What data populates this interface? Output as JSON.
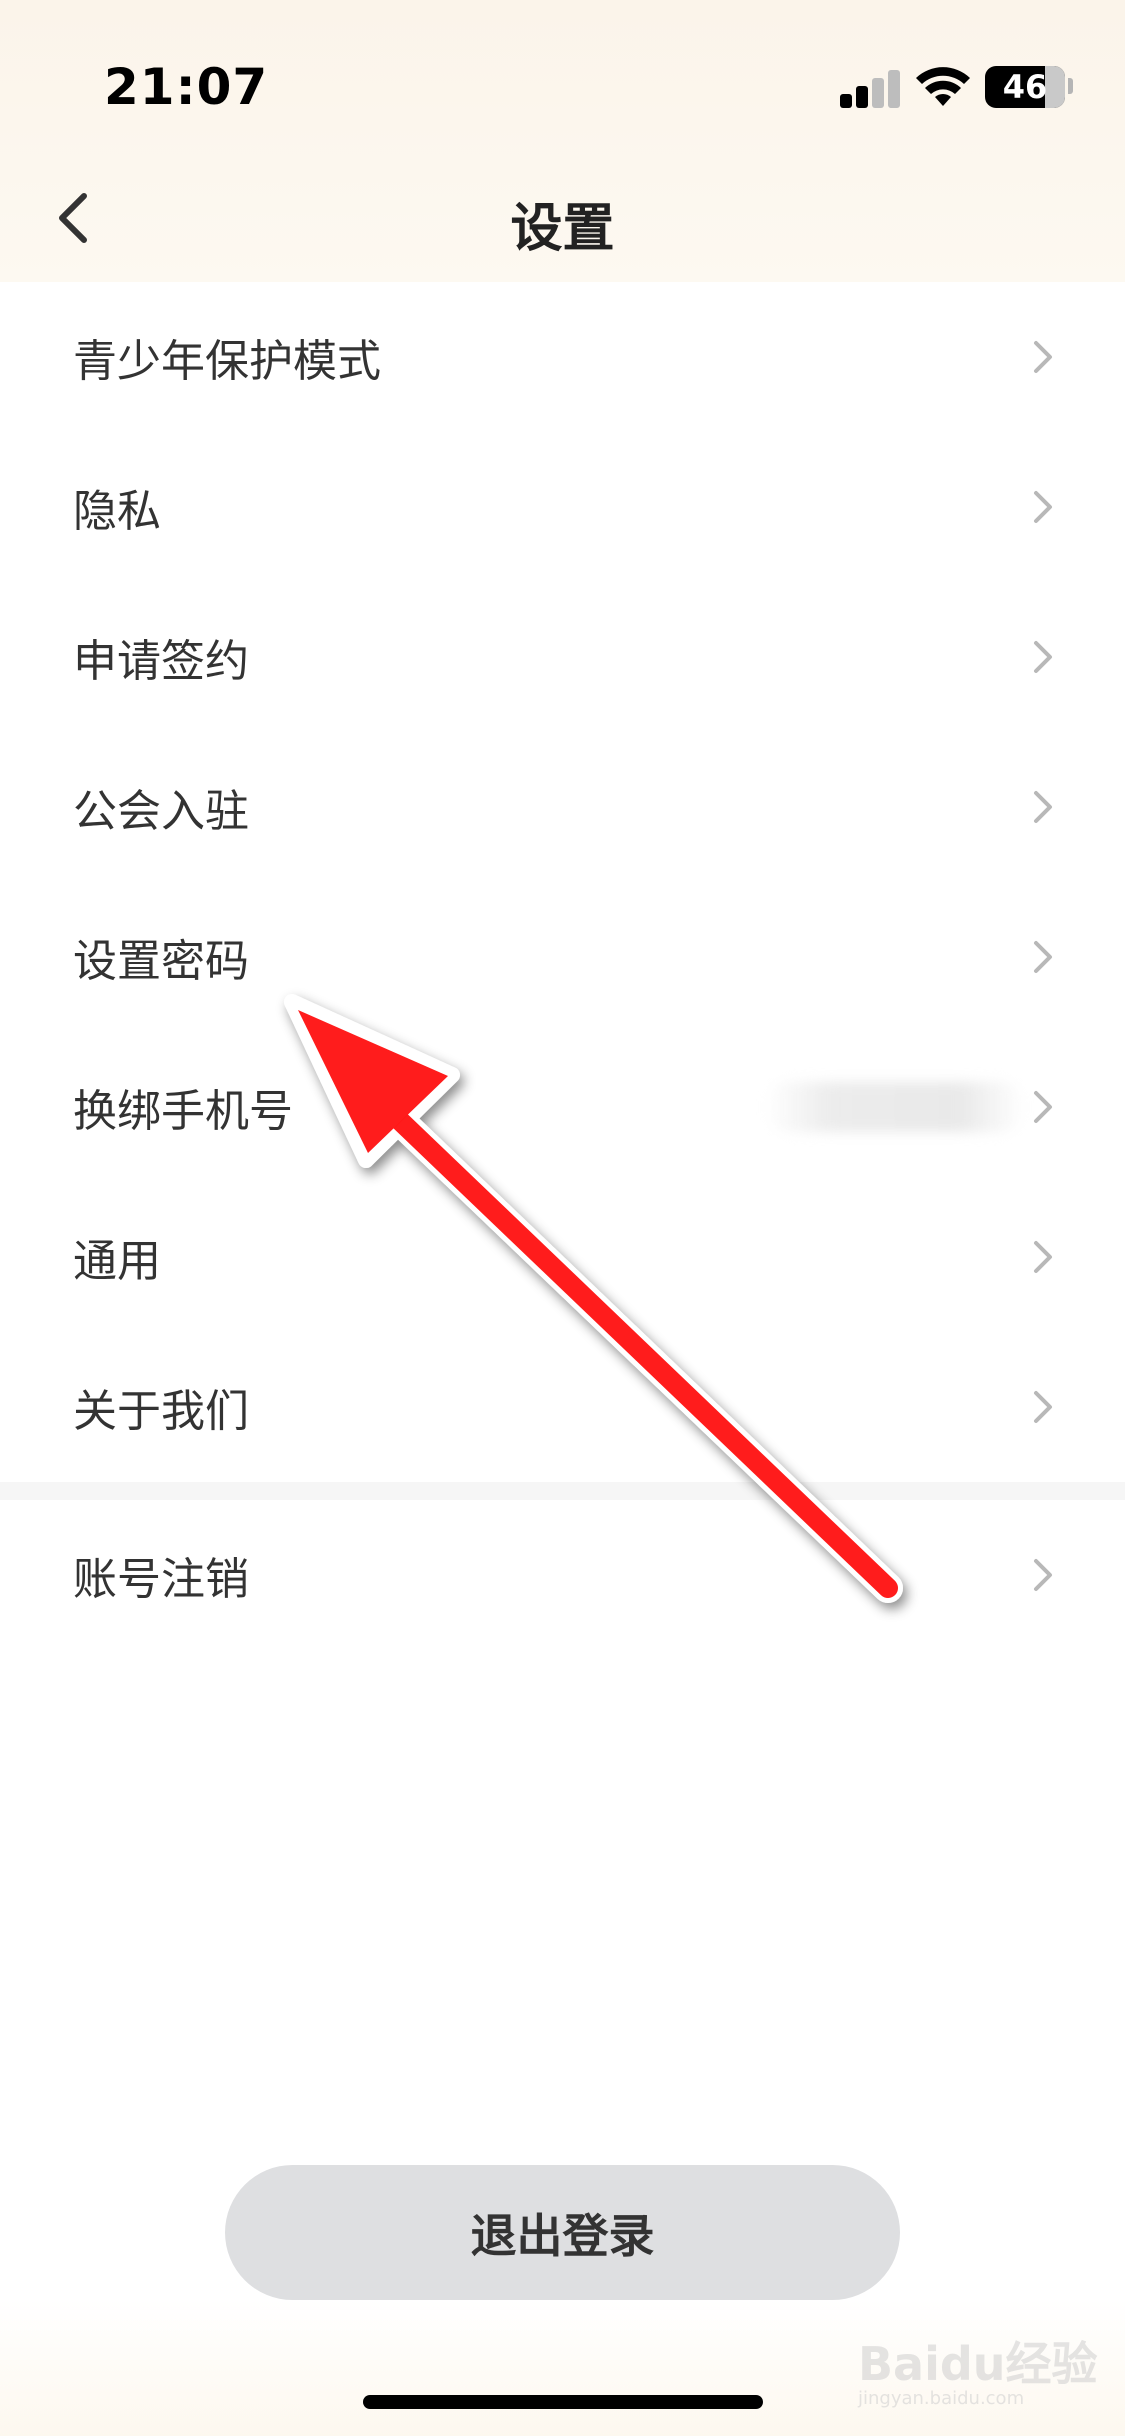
{
  "status_bar": {
    "time": "21:07",
    "battery": "46"
  },
  "nav": {
    "title": "设置"
  },
  "settings": {
    "items": [
      {
        "label": "青少年保护模式"
      },
      {
        "label": "隐私"
      },
      {
        "label": "申请签约"
      },
      {
        "label": "公会入驻"
      },
      {
        "label": "设置密码"
      },
      {
        "label": "换绑手机号"
      },
      {
        "label": "通用"
      },
      {
        "label": "关于我们"
      }
    ],
    "extra_items": [
      {
        "label": "账号注销"
      }
    ]
  },
  "logout": {
    "label": "退出登录"
  },
  "watermark": {
    "text": "Baidu经验",
    "sub": "jingyan.baidu.com"
  },
  "annotation": {
    "color": "#ff1a1a"
  }
}
